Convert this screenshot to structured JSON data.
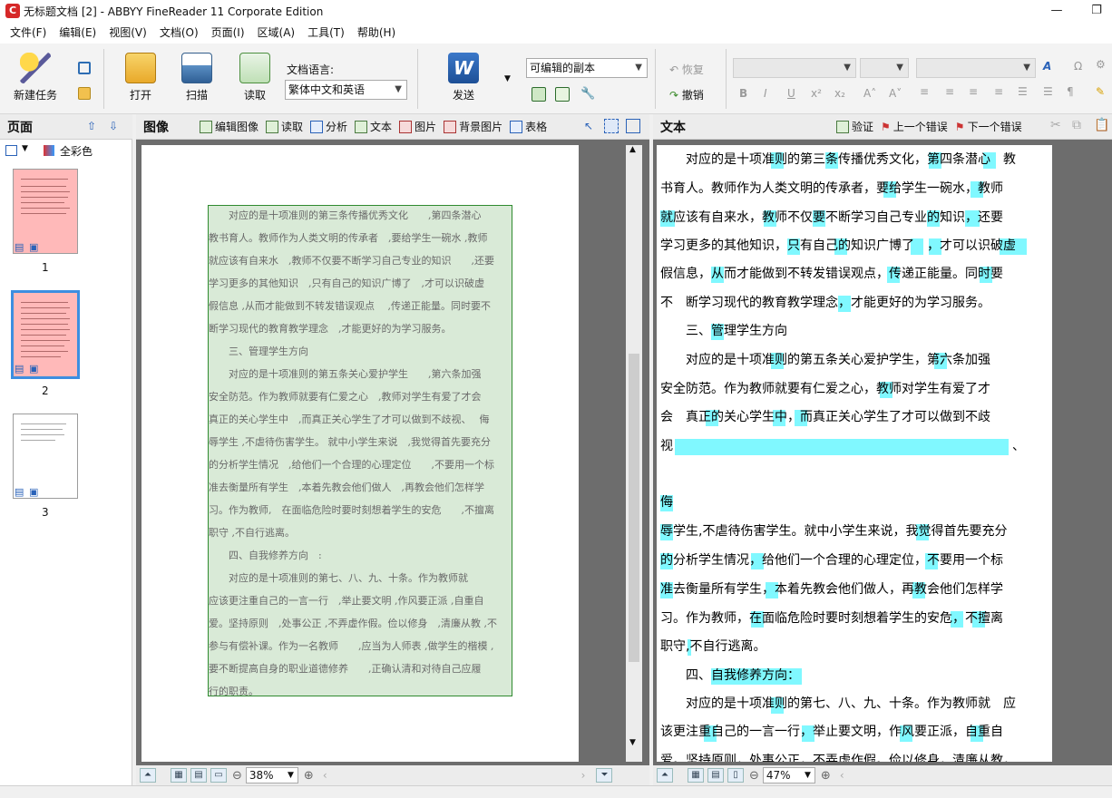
{
  "window": {
    "title": "无标题文档 [2] - ABBYY FineReader 11 Corporate Edition",
    "logo": "C"
  },
  "menu": [
    "文件(F)",
    "编辑(E)",
    "视图(V)",
    "文档(O)",
    "页面(I)",
    "区域(A)",
    "工具(T)",
    "帮助(H)"
  ],
  "toolbar": {
    "new_task": "新建任务",
    "open": "打开",
    "scan": "扫描",
    "read": "读取",
    "send": "发送",
    "doc_lang_label": "文档语言:",
    "doc_lang_value": "繁体中文和英语",
    "output_format": "可编辑的副本",
    "undo": "恢复",
    "redo": "撤销"
  },
  "pages_pane": {
    "title": "页面",
    "color_mode": "全彩色",
    "pages": [
      "1",
      "2",
      "3"
    ]
  },
  "image_pane": {
    "title": "图像",
    "tools": [
      "编辑图像",
      "读取",
      "分析",
      "文本",
      "图片",
      "背景图片",
      "表格"
    ],
    "zoom": "38%",
    "lines": [
      "　　对应的是十项准则的第三条传播优秀文化　　,第四条潜心",
      "教书育人。教师作为人类文明的传承者　,要给学生一碗水 ,教师",
      "就应该有自来水　,教师不仅要不断学习自己专业的知识　　,还要",
      "学习更多的其他知识　,只有自己的知识广博了　,才可以识破虚",
      "假信息 ,从而才能做到不转发错误观点　 ,传递正能量。同时要不",
      "断学习现代的教育教学理念　,才能更好的为学习服务。",
      "　　三、管理学生方向",
      "　　对应的是十项准则的第五条关心爱护学生　　,第六条加强",
      "安全防范。作为教师就要有仁爱之心　,教师对学生有爱了才会",
      "真正的关心学生中　,而真正关心学生了才可以做到不歧视、　 侮",
      "辱学生 ,不虐待伤害学生。 就中小学生来说　,我觉得首先要充分",
      "的分析学生情况　,给他们一个合理的心理定位　　,不要用一个标",
      "准去衡量所有学生　,本着先教会他们做人　,再教会他们怎样学",
      "习。作为教师,　在面临危险时要时刻想着学生的安危　　,不擅离",
      "职守 ,不自行逃离。",
      "　　四、自我修养方向　:",
      "　　对应的是十项准则的第七、八、九、十条。作为教师就",
      "应该更注重自己的一言一行　,举止要文明 ,作风要正派 ,自重自",
      "爱。坚持原则　,处事公正 ,不弄虚作假。俭以修身　,清廉从教 ,不",
      "参与有偿补课。作为一名教师　　,应当为人师表 ,做学生的楷模 ,",
      "要不断提高自身的职业道德修养　　,正确认清和对待自己应履",
      "行的职责。"
    ]
  },
  "text_pane": {
    "title": "文本",
    "tools": [
      "验证",
      "上一个错误",
      "下一个错误"
    ],
    "zoom": "47%",
    "lines": [
      "　　对应的是十项准则的第三条传播优秀文化，第四条潜心　教",
      "书育人。教师作为人类文明的传承者，要给学生一碗水，教师",
      "就应该有自来水，教师不仅要不断学习自己专业的知识，还要",
      "学习更多的其他知识，只有自己的知识广博了　，才可以识破虚",
      "假信息，从而才能做到不转发错误观点，传递正能量。同时要",
      "不　断学习现代的教育教学理念，才能更好的为学习服务。",
      "　　三、管理学生方向",
      "　　对应的是十项准则的第五条关心爱护学生，第六条加强",
      "安全防范。作为教师就要有仁爱之心，教师对学生有爱了才",
      "会　真正的关心学生中，而真正关心学生了才可以做到不歧",
      "视",
      "、",
      "侮",
      "辱学生,不虐待伤害学生。就中小学生来说，我觉得首先要充分",
      "的分析学生情况，给他们一个合理的心理定位，不要用一个标",
      "准去衡量所有学生，本着先教会他们做人，再教会他们怎样学",
      "习。作为教师，在面临危险时要时刻想着学生的安危，不擅离",
      "职守,不自行逃离。",
      "　　四、自我修养方向：",
      "　　对应的是十项准则的第七、八、九、十条。作为教师就　应",
      "该更注重自己的一言一行，举止要文明，作风要正派，自重自",
      "爱。坚持原则，处事公正，不弄虚作假。俭以修身，清廉从教，"
    ]
  }
}
